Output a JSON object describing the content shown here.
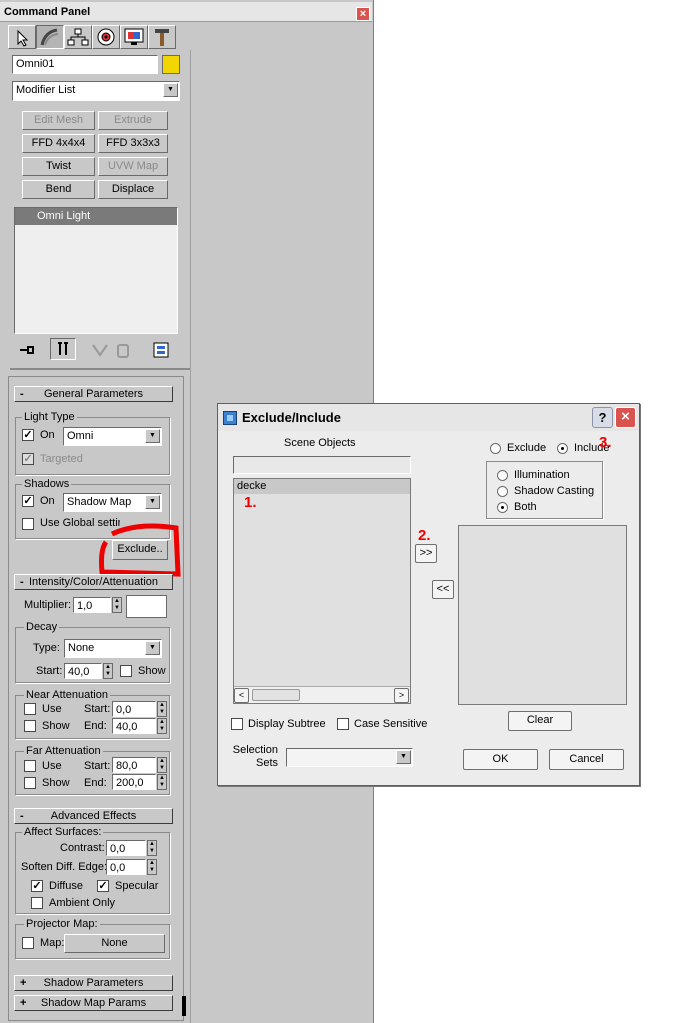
{
  "command_panel": {
    "title": "Command Panel",
    "close_glyph": "×",
    "tab_icons": [
      "create-icon",
      "modify-icon",
      "hierarchy-icon",
      "motion-icon",
      "display-icon",
      "utilities-icon"
    ],
    "object_name": "Omni01",
    "object_color": "#f2d600",
    "modifier_list": "Modifier List",
    "modifier_buttons": [
      "Edit Mesh",
      "Extrude",
      "FFD 4x4x4",
      "FFD 3x3x3",
      "Twist",
      "UVW Map",
      "Bend",
      "Displace"
    ],
    "stack_item": "Omni Light",
    "stack_icons": [
      "pin-stack-icon",
      "show-end-result-icon",
      "make-unique-icon",
      "remove-modifier-icon",
      "configure-modifier-sets-icon"
    ]
  },
  "general_parameters": {
    "rollout": "General Parameters",
    "sign": "-",
    "light_type_group": "Light Type",
    "on_label": "On",
    "type_value": "Omni",
    "targeted_label": "Targeted",
    "shadows_group": "Shadows",
    "shadows_on": "On",
    "shadow_type": "Shadow Map",
    "use_global": "Use Global settings",
    "exclude_button": "Exclude.."
  },
  "intensity": {
    "rollout": "Intensity/Color/Attenuation",
    "sign": "-",
    "multiplier_label": "Multiplier:",
    "multiplier": "1,0",
    "decay_group": "Decay",
    "type_label": "Type:",
    "type_value": "None",
    "start_label": "Start:",
    "start_value": "40,0",
    "show_label": "Show",
    "near_group": "Near Attenuation",
    "use_label": "Use",
    "show": "Show",
    "near_start": "0,0",
    "end_label": "End:",
    "near_end": "40,0",
    "far_group": "Far Attenuation",
    "far_start": "80,0",
    "far_end": "200,0"
  },
  "advanced": {
    "rollout": "Advanced Effects",
    "sign": "-",
    "affect_group": "Affect Surfaces:",
    "contrast_label": "Contrast:",
    "contrast": "0,0",
    "soften_label": "Soften Diff. Edge:",
    "soften": "0,0",
    "diffuse": "Diffuse",
    "specular": "Specular",
    "ambient": "Ambient Only",
    "projector_group": "Projector Map:",
    "map_label": "Map:",
    "map_button": "None"
  },
  "collapsed_rollouts": [
    {
      "sign": "+",
      "label": "Shadow Parameters"
    },
    {
      "sign": "+",
      "label": "Shadow Map Params"
    }
  ],
  "dialog": {
    "title": "Exclude/Include",
    "help": "?",
    "close": "×",
    "scene_objects": "Scene Objects",
    "search_value": "",
    "scene_items": [
      "decke"
    ],
    "exclude_radio": "Exclude",
    "include_radio": "Include",
    "illumination": "Illumination",
    "shadow_casting": "Shadow Casting",
    "both": "Both",
    "move_right": ">>",
    "move_left": "<<",
    "display_subtree": "Display Subtree",
    "case_sensitive": "Case Sensitive",
    "selection_sets": "Selection\nSets",
    "selection_value": "",
    "clear": "Clear",
    "ok": "OK",
    "cancel": "Cancel",
    "scroll_left": "<",
    "scroll_right": ">"
  },
  "annotations": {
    "one": "1.",
    "two": "2.",
    "three": "3."
  },
  "colors": {
    "panel": "#c8c8c8",
    "dialog_bg": "#ececec",
    "highlight": "#e00000",
    "title_blue": "#3a62b4"
  }
}
